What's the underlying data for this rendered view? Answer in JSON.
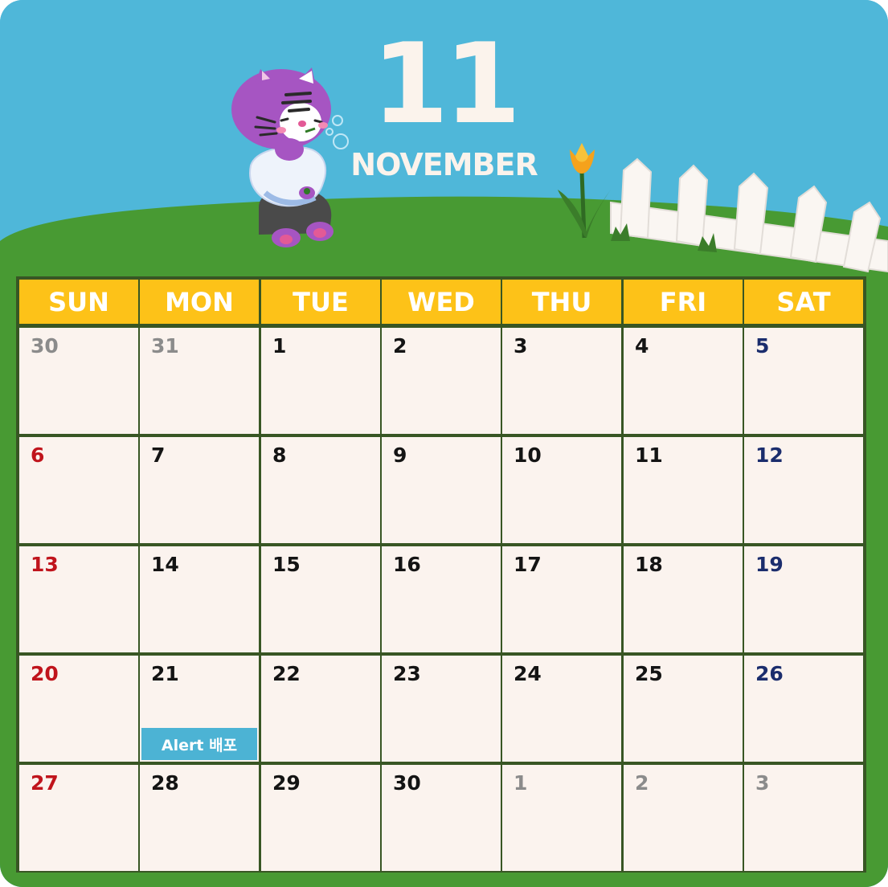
{
  "header": {
    "month_number": "11",
    "month_name": "NOVEMBER"
  },
  "weekdays": [
    "SUN",
    "MON",
    "TUE",
    "WED",
    "THU",
    "FRI",
    "SAT"
  ],
  "weeks": [
    [
      {
        "d": "30",
        "t": "other"
      },
      {
        "d": "31",
        "t": "other"
      },
      {
        "d": "1",
        "t": "norm"
      },
      {
        "d": "2",
        "t": "norm"
      },
      {
        "d": "3",
        "t": "norm"
      },
      {
        "d": "4",
        "t": "norm"
      },
      {
        "d": "5",
        "t": "sat"
      }
    ],
    [
      {
        "d": "6",
        "t": "sun"
      },
      {
        "d": "7",
        "t": "norm"
      },
      {
        "d": "8",
        "t": "norm"
      },
      {
        "d": "9",
        "t": "norm"
      },
      {
        "d": "10",
        "t": "norm"
      },
      {
        "d": "11",
        "t": "norm"
      },
      {
        "d": "12",
        "t": "sat"
      }
    ],
    [
      {
        "d": "13",
        "t": "sun"
      },
      {
        "d": "14",
        "t": "norm"
      },
      {
        "d": "15",
        "t": "norm"
      },
      {
        "d": "16",
        "t": "norm"
      },
      {
        "d": "17",
        "t": "norm"
      },
      {
        "d": "18",
        "t": "norm"
      },
      {
        "d": "19",
        "t": "sat"
      }
    ],
    [
      {
        "d": "20",
        "t": "sun"
      },
      {
        "d": "21",
        "t": "norm",
        "event": "Alert 배포"
      },
      {
        "d": "22",
        "t": "norm"
      },
      {
        "d": "23",
        "t": "norm"
      },
      {
        "d": "24",
        "t": "norm"
      },
      {
        "d": "25",
        "t": "norm"
      },
      {
        "d": "26",
        "t": "sat"
      }
    ],
    [
      {
        "d": "27",
        "t": "sun"
      },
      {
        "d": "28",
        "t": "norm"
      },
      {
        "d": "29",
        "t": "norm"
      },
      {
        "d": "30",
        "t": "norm"
      },
      {
        "d": "1",
        "t": "other"
      },
      {
        "d": "2",
        "t": "other"
      },
      {
        "d": "3",
        "t": "other"
      }
    ]
  ],
  "colors": {
    "sky": "#4fb7d9",
    "grass": "#489a33",
    "header_yellow": "#fdc218",
    "grid_line": "#385624",
    "cell_bg": "#fbf3ee",
    "sunday_red": "#c0141c",
    "saturday_navy": "#1b2d6d",
    "other_month_gray": "#8b8b8b",
    "event_blue": "#4cb3d4"
  },
  "decor": {
    "mascot": "purple-tiger-cat-blowing-bubbles",
    "flower": "orange-tulip",
    "fence": "white-picket-fence"
  }
}
